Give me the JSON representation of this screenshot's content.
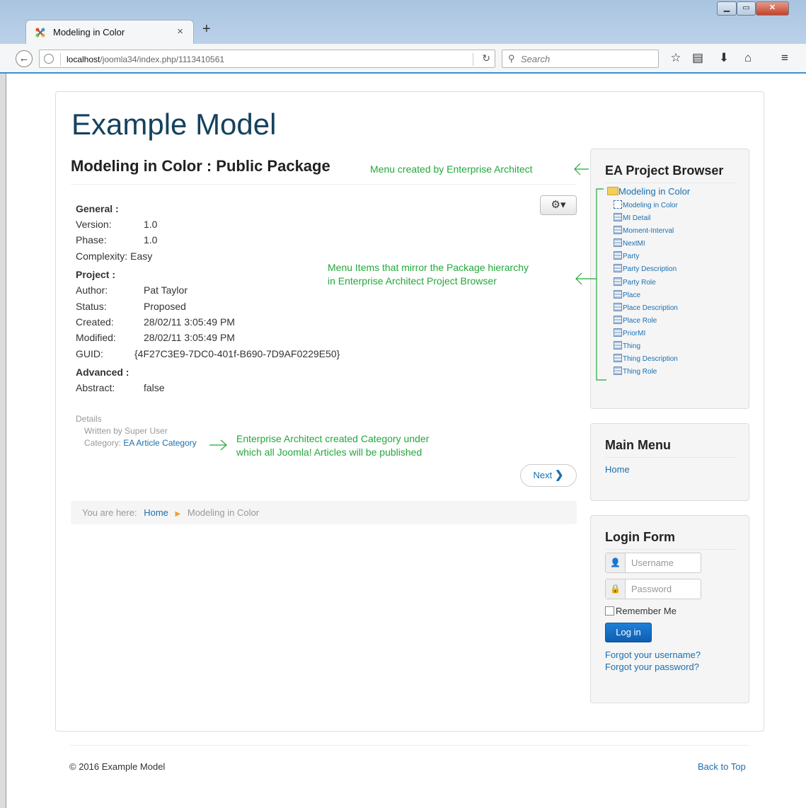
{
  "browser": {
    "tab_title": "Modeling in Color",
    "tab_close": "×",
    "new_tab": "+",
    "url_host": "localhost",
    "url_path": "/joomla34/index.php/1113410561",
    "search_placeholder": "Search",
    "icons": [
      "back-icon",
      "globe-icon",
      "reload-icon",
      "search-icon",
      "bookmark-star-icon",
      "reading-list-icon",
      "download-icon",
      "home-icon",
      "menu-icon"
    ],
    "window_buttons": [
      "minimize",
      "maximize",
      "close"
    ]
  },
  "site": {
    "title": "Example Model"
  },
  "article": {
    "title": "Modeling in Color : Public Package",
    "sections": [
      {
        "heading": "General :",
        "rows": [
          {
            "label": "Version:",
            "value": "1.0"
          },
          {
            "label": "Phase:",
            "value": "1.0"
          },
          {
            "label": "Complexity:",
            "value": "Easy"
          }
        ]
      },
      {
        "heading": "Project :",
        "rows": [
          {
            "label": "Author:",
            "value": "Pat Taylor"
          },
          {
            "label": "Status:",
            "value": "Proposed"
          },
          {
            "label": "Created:",
            "value": "28/02/11 3:05:49 PM"
          },
          {
            "label": "Modified:",
            "value": "28/02/11 3:05:49 PM"
          },
          {
            "label": "GUID:",
            "value": "{4F27C3E9-7DC0-401f-B690-7D9AF0229E50}"
          }
        ]
      },
      {
        "heading": "Advanced :",
        "rows": [
          {
            "label": "Abstract:",
            "value": "false"
          }
        ]
      }
    ],
    "details_heading": "Details",
    "written_by": "Written by Super User",
    "category_label": "Category:",
    "category_link": "EA Article Category",
    "next_label": "Next"
  },
  "breadcrumb": {
    "prefix": "You are here:",
    "home": "Home",
    "current": "Modeling in Color"
  },
  "annotations": {
    "menu_created": "Menu created by Enterprise Architect",
    "menu_items_line1": "Menu Items that mirror the Package hierarchy",
    "menu_items_line2": "in Enterprise Architect Project Browser",
    "category_line1": "Enterprise Architect created Category under",
    "category_line2": "which all Joomla! Articles will be published",
    "color": "#22a83a"
  },
  "ea_browser": {
    "heading": "EA Project Browser",
    "root": "Modeling in Color",
    "items": [
      {
        "label": "Modeling in Color",
        "icon": "diagram-icon"
      },
      {
        "label": "MI Detail",
        "icon": "document-icon"
      },
      {
        "label": "Moment-Interval",
        "icon": "document-icon"
      },
      {
        "label": "NextMI",
        "icon": "document-icon"
      },
      {
        "label": "Party",
        "icon": "document-icon"
      },
      {
        "label": "Party Description",
        "icon": "document-icon"
      },
      {
        "label": "Party Role",
        "icon": "document-icon"
      },
      {
        "label": "Place",
        "icon": "document-icon"
      },
      {
        "label": "Place Description",
        "icon": "document-icon"
      },
      {
        "label": "Place Role",
        "icon": "document-icon"
      },
      {
        "label": "PriorMI",
        "icon": "document-icon"
      },
      {
        "label": "Thing",
        "icon": "document-icon"
      },
      {
        "label": "Thing Description",
        "icon": "document-icon"
      },
      {
        "label": "Thing Role",
        "icon": "document-icon"
      }
    ]
  },
  "main_menu": {
    "heading": "Main Menu",
    "items": [
      "Home"
    ]
  },
  "login": {
    "heading": "Login Form",
    "username_placeholder": "Username",
    "password_placeholder": "Password",
    "remember_label": "Remember Me",
    "button_label": "Log in",
    "forgot_username": "Forgot your username?",
    "forgot_password": "Forgot your password?"
  },
  "footer": {
    "copyright": "© 2016 Example Model",
    "back_to_top": "Back to Top"
  },
  "colors": {
    "brand": "#14425e",
    "link": "#1a6fb0",
    "annotation": "#22a83a",
    "login_button": "#1f7fd8"
  }
}
